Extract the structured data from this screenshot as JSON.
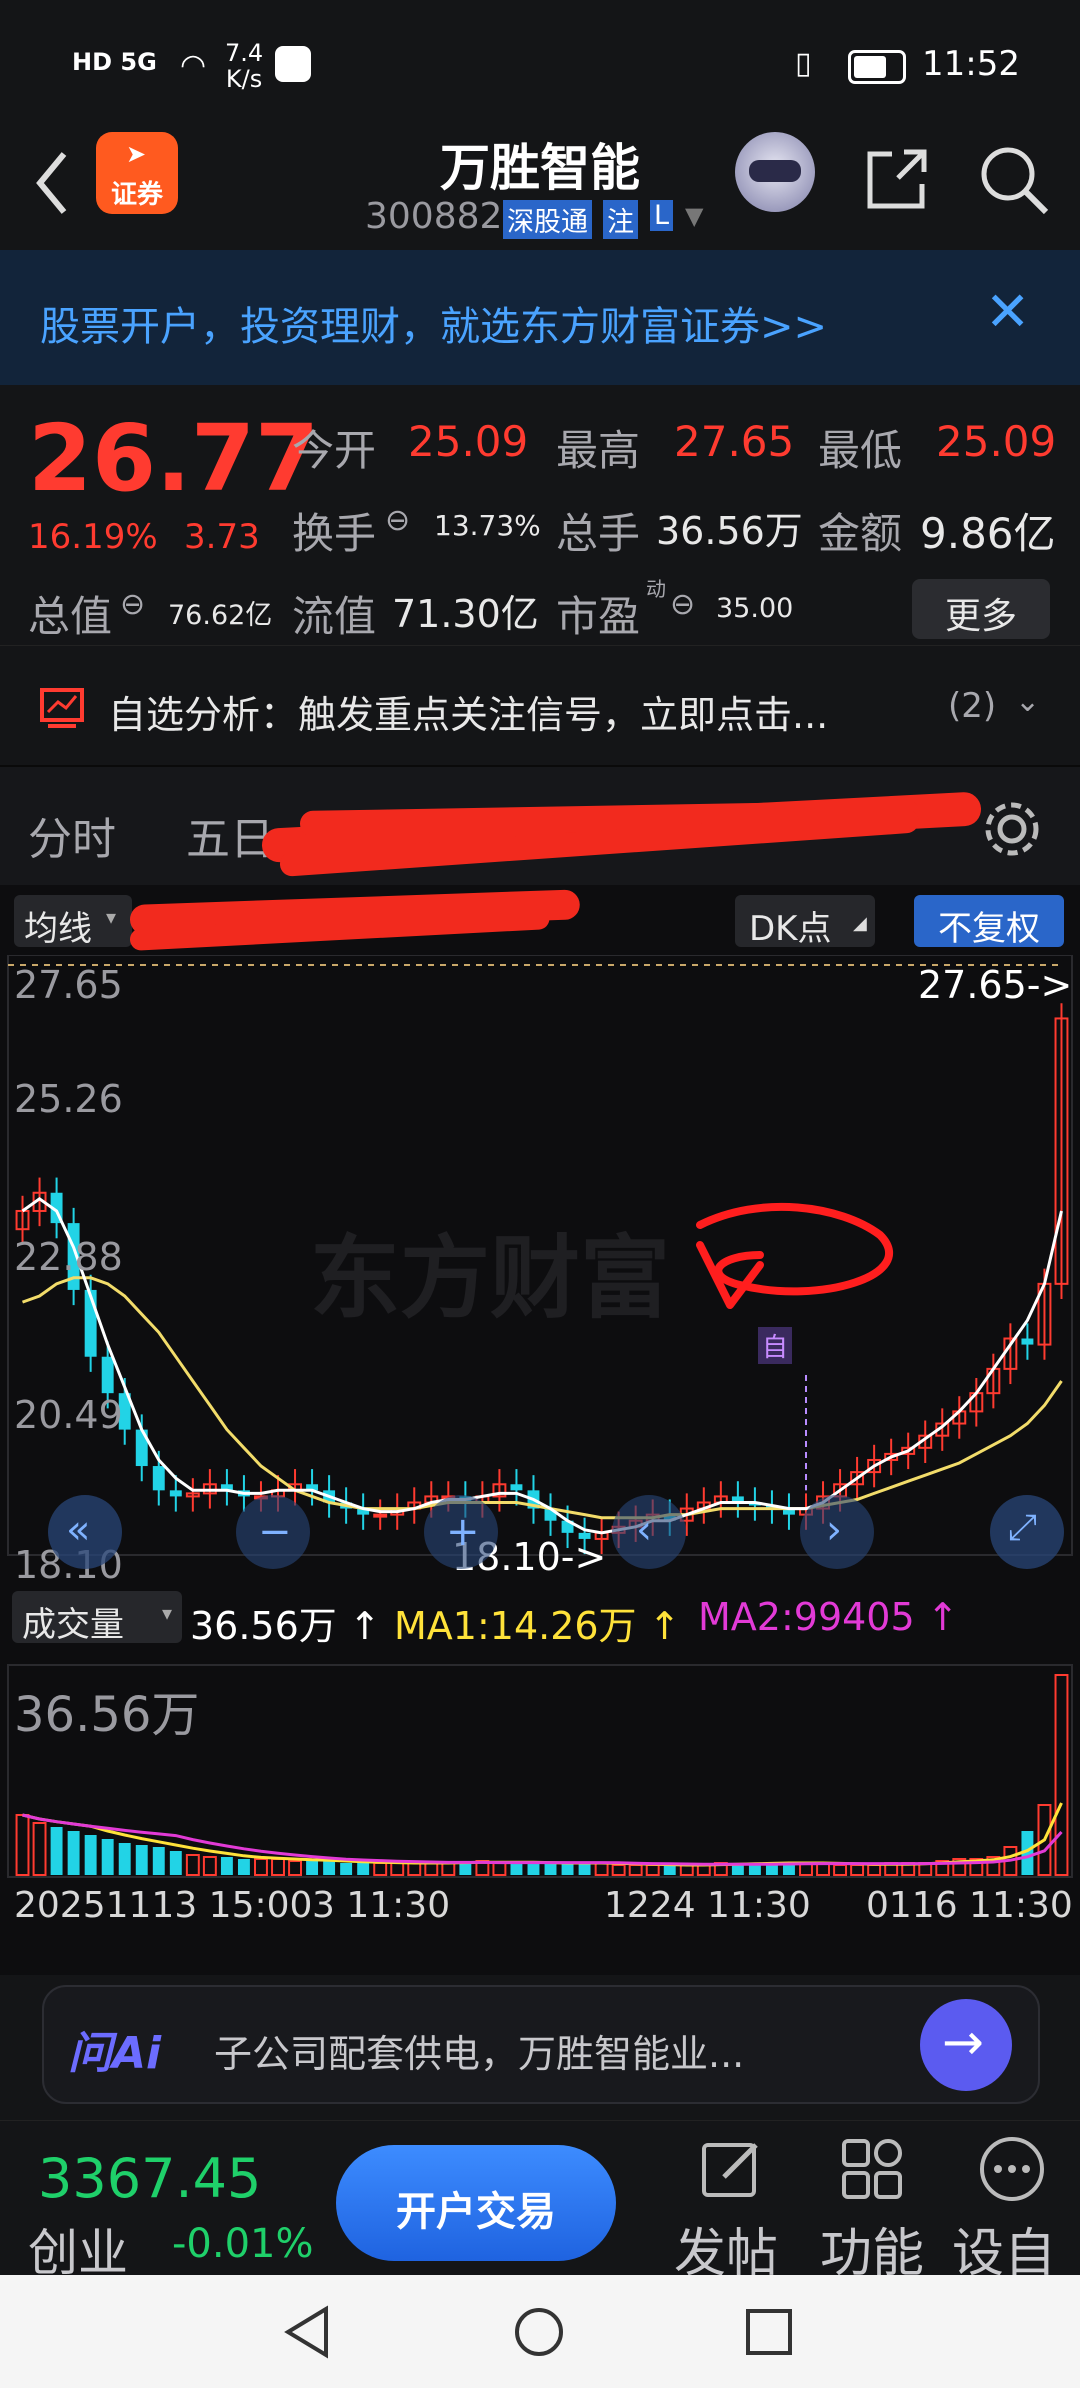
{
  "status_bar": {
    "network": "HD 5G",
    "speed_value": "7.4",
    "speed_unit": "K/s",
    "time": "11:52"
  },
  "header": {
    "logo_text": "证券",
    "title": "万胜智能",
    "code": "300882",
    "tag_sgt": "深股通",
    "tag_zhu": "注",
    "tag_l": "L"
  },
  "banner": {
    "text": "股票开户，投资理财，就选东方财富证券>>"
  },
  "quote": {
    "price": "26.77",
    "change_pct": "16.19%",
    "change": "3.73",
    "open_label": "今开",
    "open": "25.09",
    "high_label": "最高",
    "high": "27.65",
    "low_label": "最低",
    "low": "25.09",
    "turnover_label": "换手",
    "turnover": "13.73%",
    "volume_label": "总手",
    "volume": "36.56万",
    "amount_label": "金额",
    "amount": "9.86亿",
    "mktcap_label": "总值",
    "mktcap": "76.62亿",
    "float_label": "流值",
    "float_cap": "71.30亿",
    "pe_label": "市盈",
    "pe_sup": "动",
    "pe": "35.00",
    "more_label": "更多"
  },
  "signal": {
    "text": "自选分析：触发重点关注信号，立即点击...",
    "count": "(2)"
  },
  "tabs": {
    "fenshi": "分时",
    "wuri": "五日"
  },
  "chart_toolbar": {
    "ma_select": "均线",
    "ma_text": "MA",
    "dk_label": "DK点",
    "fq_label": "不复权"
  },
  "chart_data": [
    {
      "type": "candlestick",
      "y_ticks": [
        "27.65",
        "25.26",
        "22.88",
        "20.49",
        "18.10"
      ],
      "ylim": [
        18.1,
        27.65
      ],
      "max_marker": "27.65->",
      "min_marker": "18.10->",
      "self_mark": "自",
      "watermark": "东方财富",
      "close": [
        23.6,
        23.9,
        23.4,
        22.3,
        21.2,
        20.6,
        20.0,
        19.4,
        19.0,
        18.9,
        18.95,
        19.1,
        19.0,
        18.9,
        18.9,
        19.0,
        19.1,
        19.0,
        18.8,
        18.7,
        18.6,
        18.6,
        18.7,
        18.8,
        18.9,
        18.9,
        18.8,
        18.9,
        19.1,
        19.0,
        18.7,
        18.5,
        18.3,
        18.2,
        18.3,
        18.4,
        18.5,
        18.6,
        18.5,
        18.7,
        18.8,
        18.9,
        18.8,
        18.75,
        18.7,
        18.6,
        18.7,
        18.9,
        19.1,
        19.3,
        19.5,
        19.6,
        19.7,
        19.9,
        20.1,
        20.3,
        20.6,
        21.0,
        21.5,
        21.4,
        22.4,
        26.77
      ],
      "ma_white": [
        23.6,
        23.8,
        23.6,
        23.0,
        22.2,
        21.4,
        20.7,
        20.0,
        19.5,
        19.2,
        19.0,
        19.0,
        19.0,
        18.95,
        18.95,
        19.0,
        19.0,
        19.0,
        18.9,
        18.8,
        18.7,
        18.65,
        18.65,
        18.7,
        18.8,
        18.85,
        18.85,
        18.9,
        18.95,
        18.95,
        18.85,
        18.7,
        18.5,
        18.35,
        18.3,
        18.35,
        18.4,
        18.5,
        18.5,
        18.6,
        18.7,
        18.8,
        18.8,
        18.8,
        18.75,
        18.7,
        18.7,
        18.8,
        19.0,
        19.2,
        19.4,
        19.55,
        19.65,
        19.85,
        20.05,
        20.3,
        20.6,
        21.0,
        21.4,
        21.8,
        22.4,
        23.6
      ],
      "ma_yellow": [
        22.1,
        22.2,
        22.4,
        22.5,
        22.5,
        22.4,
        22.2,
        21.9,
        21.6,
        21.2,
        20.8,
        20.4,
        20.0,
        19.7,
        19.4,
        19.2,
        19.0,
        18.9,
        18.8,
        18.75,
        18.7,
        18.7,
        18.7,
        18.7,
        18.75,
        18.8,
        18.8,
        18.8,
        18.8,
        18.8,
        18.75,
        18.7,
        18.65,
        18.6,
        18.55,
        18.55,
        18.55,
        18.55,
        18.6,
        18.6,
        18.65,
        18.7,
        18.7,
        18.7,
        18.7,
        18.7,
        18.7,
        18.75,
        18.8,
        18.85,
        18.95,
        19.05,
        19.15,
        19.25,
        19.35,
        19.45,
        19.6,
        19.75,
        19.9,
        20.1,
        20.4,
        20.8
      ]
    },
    {
      "type": "bar",
      "vol_label": "成交量",
      "vol_value": "36.56万 ↑",
      "ma1_text": "MA1:14.26万 ↑",
      "ma2_text": "MA2:99405 ↑",
      "y_top": "36.56万",
      "dates": [
        "20251113 15:00",
        "3 11:30",
        "1224 11:30",
        "0116 11:30"
      ],
      "values": [
        30,
        26,
        24,
        22,
        20,
        18,
        16,
        15,
        14,
        12,
        10,
        9,
        9,
        8,
        8,
        8,
        7,
        7,
        7,
        6,
        6,
        6,
        6,
        6,
        6,
        6,
        7,
        7,
        6,
        6,
        6,
        6,
        6,
        6,
        6,
        5,
        5,
        5,
        5,
        5,
        5,
        6,
        6,
        6,
        6,
        6,
        6,
        6,
        5,
        5,
        5,
        6,
        6,
        6,
        7,
        8,
        8,
        9,
        14,
        22,
        35,
        100
      ]
    }
  ],
  "ai_bar": {
    "logo": "问Ai",
    "text": "子公司配套供电，万胜智能业..."
  },
  "bottom_nav": {
    "index_value": "3367.45",
    "index_name": "创业",
    "index_change": "-0.01%",
    "trade_button": "开户交易",
    "post_label": "发帖",
    "func_label": "功能",
    "settings_label": "设自"
  }
}
